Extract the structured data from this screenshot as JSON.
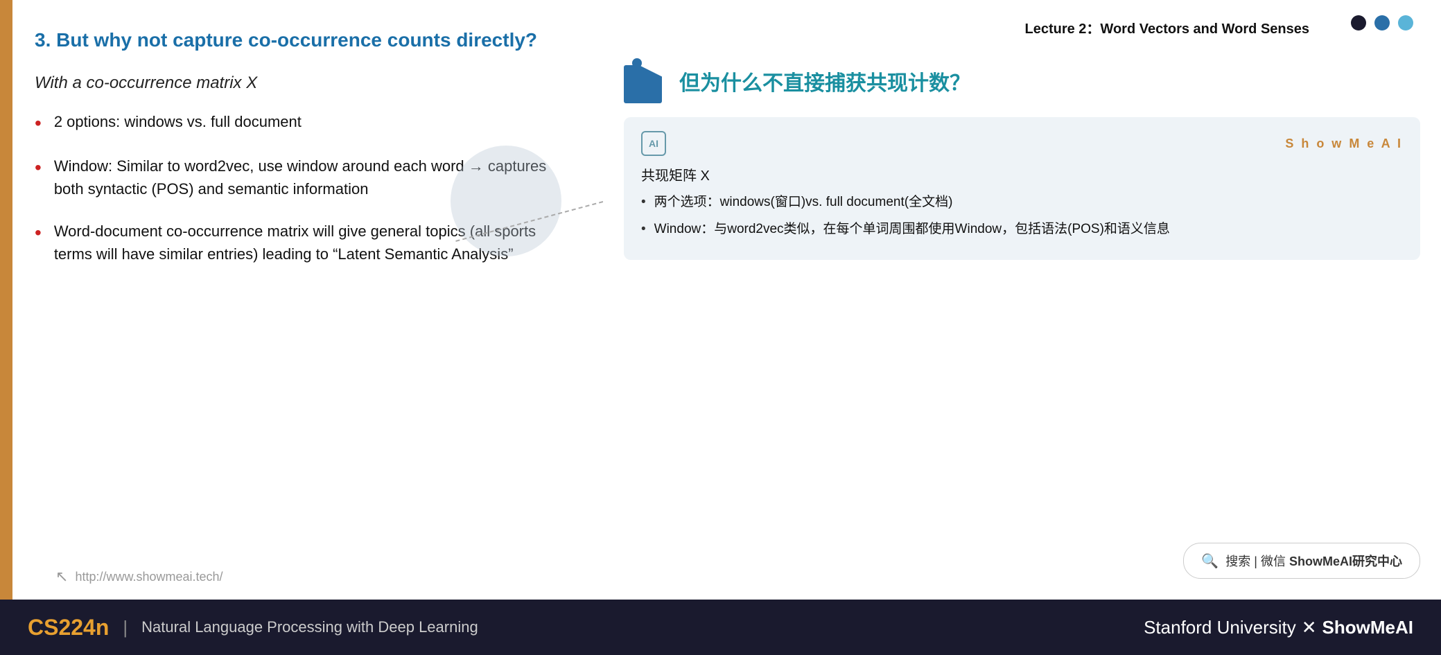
{
  "header": {
    "lecture_title": "Lecture 2：Word Vectors and Word Senses"
  },
  "slide": {
    "heading": "3. But why not capture co-occurrence counts directly?",
    "intro": "With a co-occurrence matrix X",
    "bullets": [
      {
        "text": "2 options: windows vs. full document"
      },
      {
        "text": "Window: Similar to word2vec, use window around each word → captures both syntactic (POS) and semantic information"
      },
      {
        "text": "Word-document co-occurrence matrix will give general topics (all sports terms will have similar entries) leading to “Latent Semantic Analysis”"
      }
    ],
    "footer_url": "http://www.showmeai.tech/"
  },
  "chinese_slide": {
    "heading": "但为什么不直接捕获共现计数？",
    "card": {
      "brand": "S h o w M e A I",
      "ai_label": "AI",
      "title": "共现矩阵 X",
      "bullets": [
        "两个选项：windows(窗口)vs. full document(全文档)",
        "Window：与word2vec类似，在每个单词周围都使用Window，包括语法(POS)和语义信息"
      ]
    },
    "search_bar": {
      "icon": "🔍",
      "text": "搜索 | 微信 ShowMeAI研究中心"
    },
    "dots": [
      {
        "color": "#1a1a2e"
      },
      {
        "color": "#2a6fa8"
      },
      {
        "color": "#5ab4d8"
      }
    ]
  },
  "bottom_bar": {
    "course": "CS224n",
    "separator": "|",
    "subtitle": "Natural Language Processing with Deep Learning",
    "right_text_1": "Stanford University",
    "right_x": "✕",
    "right_text_2": "ShowMeAI"
  }
}
